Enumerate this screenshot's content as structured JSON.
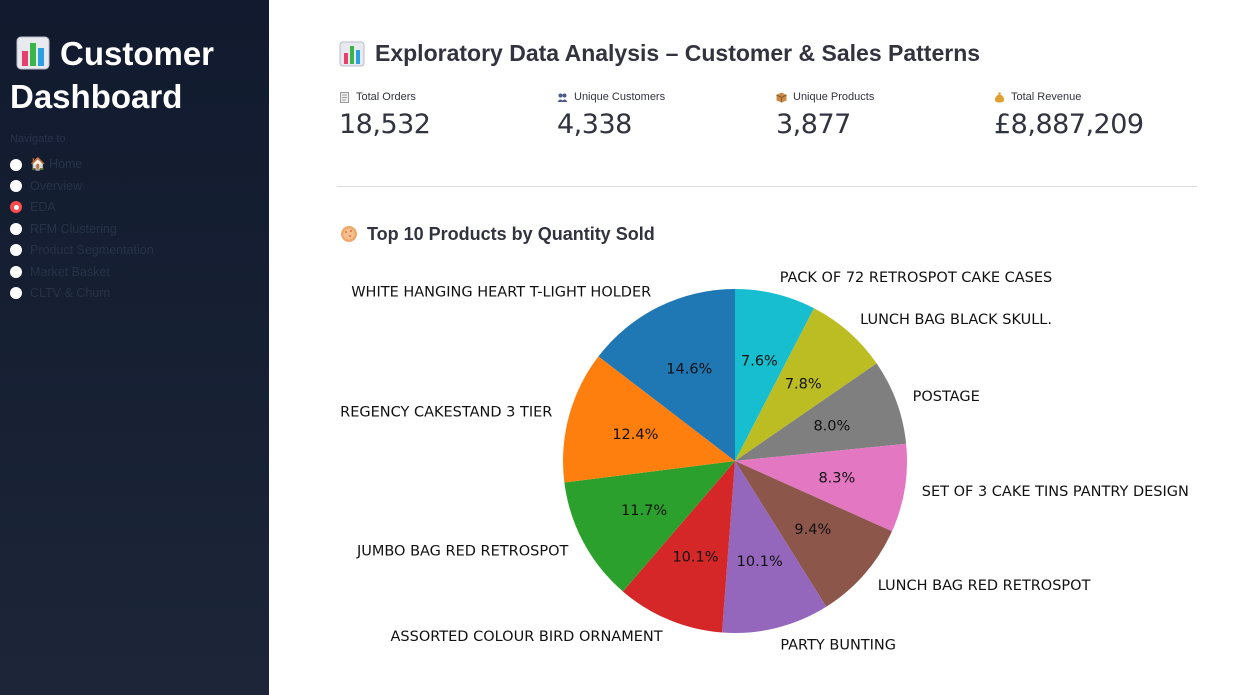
{
  "sidebar": {
    "title": "Customer Dashboard",
    "nav_label": "Navigate to",
    "items": [
      {
        "label": "🏠 Home",
        "selected": false
      },
      {
        "label": "Overview",
        "selected": false
      },
      {
        "label": "EDA",
        "selected": true
      },
      {
        "label": "RFM Clustering",
        "selected": false
      },
      {
        "label": "Product Segmentation",
        "selected": false
      },
      {
        "label": "Market Basket",
        "selected": false
      },
      {
        "label": "CLTV & Churn",
        "selected": false
      }
    ]
  },
  "main": {
    "title": "Exploratory Data Analysis – Customer & Sales Patterns",
    "metrics": [
      {
        "label": "Total Orders",
        "value": "18,532",
        "icon": "receipt-icon"
      },
      {
        "label": "Unique Customers",
        "value": "4,338",
        "icon": "people-icon"
      },
      {
        "label": "Unique Products",
        "value": "3,877",
        "icon": "package-icon"
      },
      {
        "label": "Total Revenue",
        "value": "£8,887,209",
        "icon": "money-bag-icon"
      }
    ],
    "chart_heading": "Top 10 Products by Quantity Sold"
  },
  "chart_data": {
    "type": "pie",
    "title": "",
    "start_angle_deg": 90,
    "direction": "clockwise",
    "slices": [
      {
        "label": "PACK OF 72 RETROSPOT CAKE CASES",
        "pct_label": "7.6%",
        "value": 7.6,
        "color": "#17becf"
      },
      {
        "label": "LUNCH BAG  BLACK SKULL.",
        "pct_label": "7.8%",
        "value": 7.8,
        "color": "#bcbd22"
      },
      {
        "label": "POSTAGE",
        "pct_label": "8.0%",
        "value": 8.0,
        "color": "#7f7f7f"
      },
      {
        "label": "SET OF 3 CAKE TINS PANTRY DESIGN",
        "pct_label": "8.3%",
        "value": 8.3,
        "color": "#e377c2"
      },
      {
        "label": "LUNCH BAG RED RETROSPOT",
        "pct_label": "9.4%",
        "value": 9.4,
        "color": "#8c564b"
      },
      {
        "label": "PARTY BUNTING",
        "pct_label": "10.1%",
        "value": 10.1,
        "color": "#9467bd"
      },
      {
        "label": "ASSORTED COLOUR BIRD ORNAMENT",
        "pct_label": "10.1%",
        "value": 10.1,
        "color": "#d62728"
      },
      {
        "label": "JUMBO BAG RED RETROSPOT",
        "pct_label": "11.7%",
        "value": 11.7,
        "color": "#2ca02c"
      },
      {
        "label": "REGENCY CAKESTAND 3 TIER",
        "pct_label": "12.4%",
        "value": 12.4,
        "color": "#ff7f0e"
      },
      {
        "label": "WHITE HANGING HEART T-LIGHT HOLDER",
        "pct_label": "14.6%",
        "value": 14.6,
        "color": "#1f77b4"
      }
    ]
  }
}
